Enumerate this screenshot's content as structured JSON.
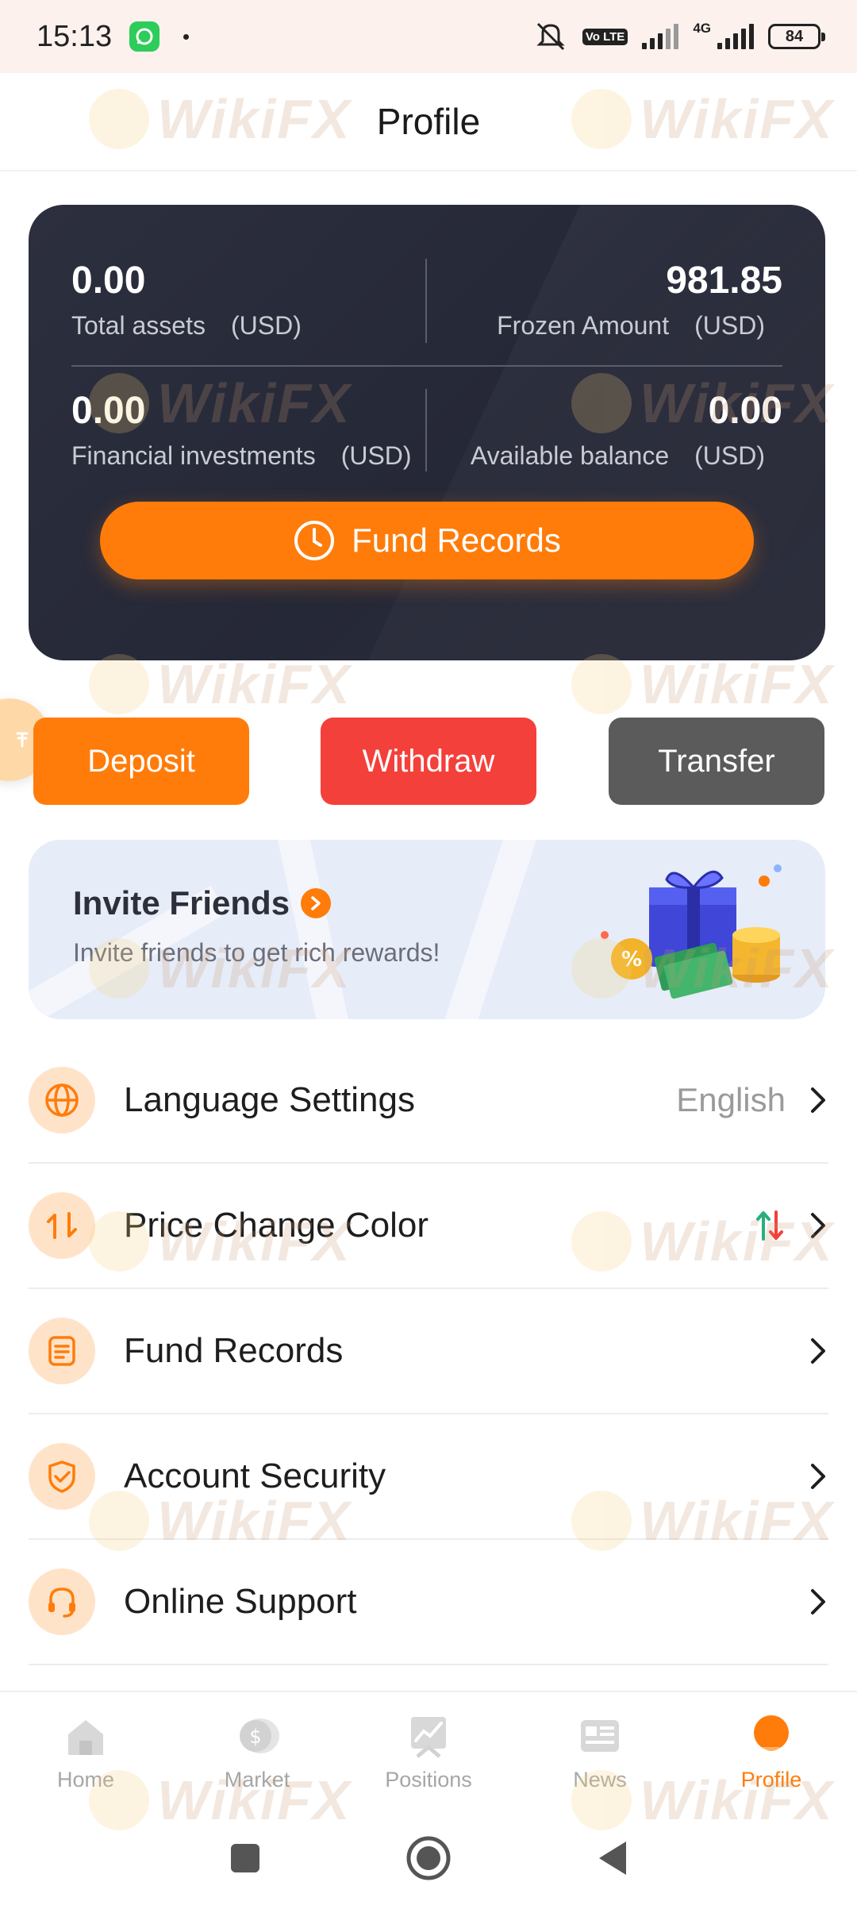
{
  "status_bar": {
    "time": "15:13",
    "network": "4G",
    "volte": "Vo LTE",
    "battery": "84"
  },
  "header": {
    "title": "Profile"
  },
  "assets": {
    "total_assets": {
      "value": "0.00",
      "label": "Total assets　(USD)"
    },
    "frozen_amount": {
      "value": "981.85",
      "label": "Frozen Amount　(USD)"
    },
    "financial_investments": {
      "value": "0.00",
      "label": "Financial investments　(USD)"
    },
    "available_balance": {
      "value": "0.00",
      "label": "Available balance　(USD)"
    },
    "fund_records_button": "Fund Records"
  },
  "actions": {
    "deposit": "Deposit",
    "withdraw": "Withdraw",
    "transfer": "Transfer"
  },
  "invite": {
    "title": "Invite Friends",
    "subtitle": "Invite friends to get rich rewards!"
  },
  "menu": [
    {
      "label": "Language Settings",
      "value": "English",
      "icon": "globe-icon"
    },
    {
      "label": "Price Change Color",
      "value": "",
      "icon": "swap-arrows-icon"
    },
    {
      "label": "Fund Records",
      "value": "",
      "icon": "document-icon"
    },
    {
      "label": "Account Security",
      "value": "",
      "icon": "shield-check-icon"
    },
    {
      "label": "Online Support",
      "value": "",
      "icon": "headset-icon"
    }
  ],
  "bottom_nav": [
    {
      "label": "Home",
      "icon": "home-icon",
      "active": false
    },
    {
      "label": "Market",
      "icon": "coin-icon",
      "active": false
    },
    {
      "label": "Positions",
      "icon": "chart-icon",
      "active": false
    },
    {
      "label": "News",
      "icon": "newspaper-icon",
      "active": false
    },
    {
      "label": "Profile",
      "icon": "profile-icon",
      "active": true
    }
  ],
  "watermark_text": "WikiFX",
  "colors": {
    "accent": "#ff7c0a",
    "withdraw": "#f4403a",
    "transfer": "#5b5b5b",
    "card_bg": "#2a2d3b",
    "up_color": "#27b07a",
    "down_color": "#f4403a"
  }
}
